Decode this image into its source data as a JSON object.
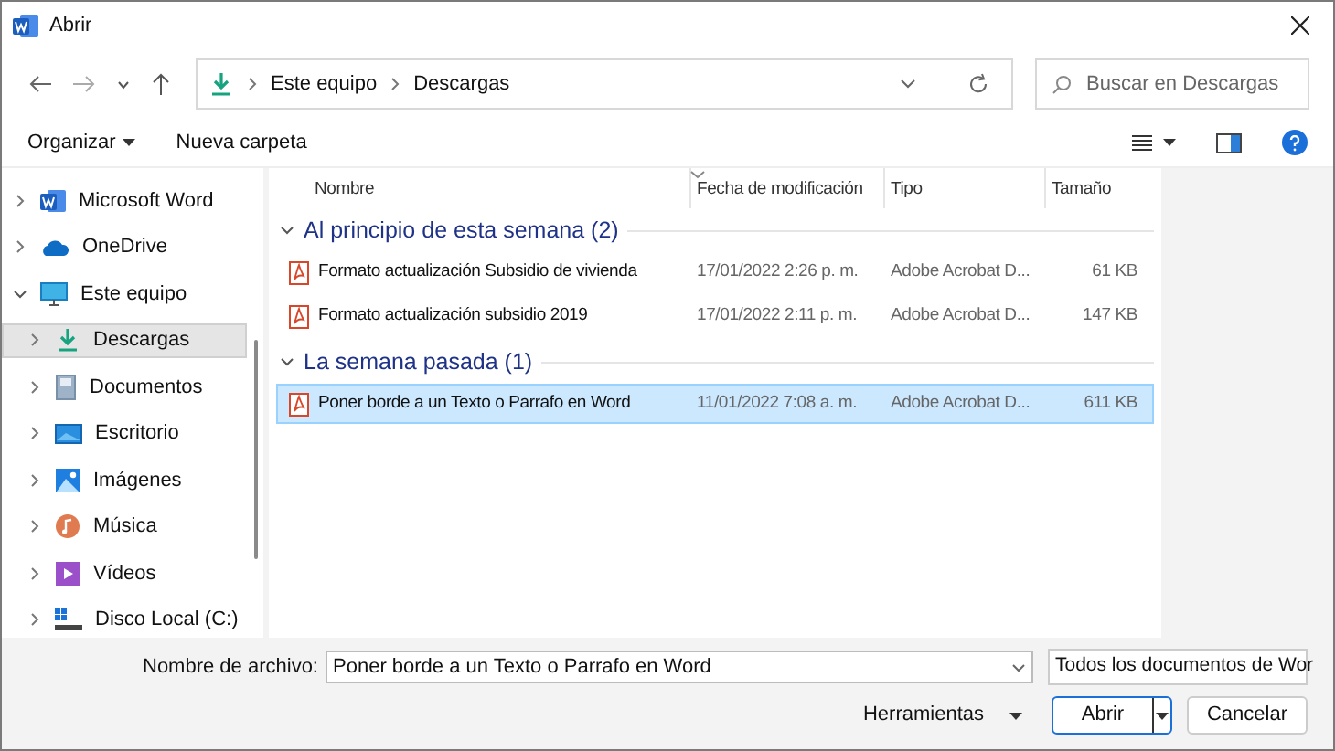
{
  "window": {
    "title": "Abrir"
  },
  "breadcrumb": [
    "Este equipo",
    "Descargas"
  ],
  "search": {
    "placeholder": "Buscar en Descargas"
  },
  "toolbar": {
    "organize": "Organizar",
    "new_folder": "Nueva carpeta"
  },
  "sidebar": {
    "items": [
      {
        "label": "Microsoft Word",
        "kind": "word",
        "expanded": false,
        "selected": false
      },
      {
        "label": "OneDrive",
        "kind": "cloud",
        "expanded": false,
        "selected": false
      },
      {
        "label": "Este equipo",
        "kind": "pc",
        "expanded": true,
        "selected": false,
        "children": [
          {
            "label": "Descargas",
            "kind": "download",
            "expanded": false,
            "selected": true
          },
          {
            "label": "Documentos",
            "kind": "document",
            "expanded": false,
            "selected": false
          },
          {
            "label": "Escritorio",
            "kind": "desktop",
            "expanded": false,
            "selected": false
          },
          {
            "label": "Imágenes",
            "kind": "images",
            "expanded": false,
            "selected": false
          },
          {
            "label": "Música",
            "kind": "music",
            "expanded": false,
            "selected": false
          },
          {
            "label": "Vídeos",
            "kind": "video",
            "expanded": false,
            "selected": false
          },
          {
            "label": "Disco Local (C:)",
            "kind": "drive",
            "expanded": false,
            "selected": false
          }
        ]
      }
    ]
  },
  "file_list": {
    "columns": [
      "Nombre",
      "Fecha de modificación",
      "Tipo",
      "Tamaño"
    ],
    "groups": [
      {
        "title": "Al principio de esta semana (2)",
        "expanded": true,
        "files": [
          {
            "name": "Formato actualización Subsidio de vivienda",
            "date": "17/01/2022 2:26 p. m.",
            "type": "Adobe Acrobat D...",
            "size": "61 KB",
            "selected": false
          },
          {
            "name": "Formato actualización subsidio 2019",
            "date": "17/01/2022 2:11 p. m.",
            "type": "Adobe Acrobat D...",
            "size": "147 KB",
            "selected": false
          }
        ]
      },
      {
        "title": "La semana pasada (1)",
        "expanded": true,
        "files": [
          {
            "name": "Poner borde a un Texto o Parrafo en Word",
            "date": "11/01/2022 7:08 a. m.",
            "type": "Adobe Acrobat D...",
            "size": "611 KB",
            "selected": true
          }
        ]
      }
    ]
  },
  "footer": {
    "filename_label": "Nombre de archivo:",
    "filename": "Poner borde a un Texto o Parrafo en Word",
    "filter": "Todos los documentos de Wor",
    "tools": "Herramientas",
    "open": "Abrir",
    "cancel": "Cancelar"
  }
}
